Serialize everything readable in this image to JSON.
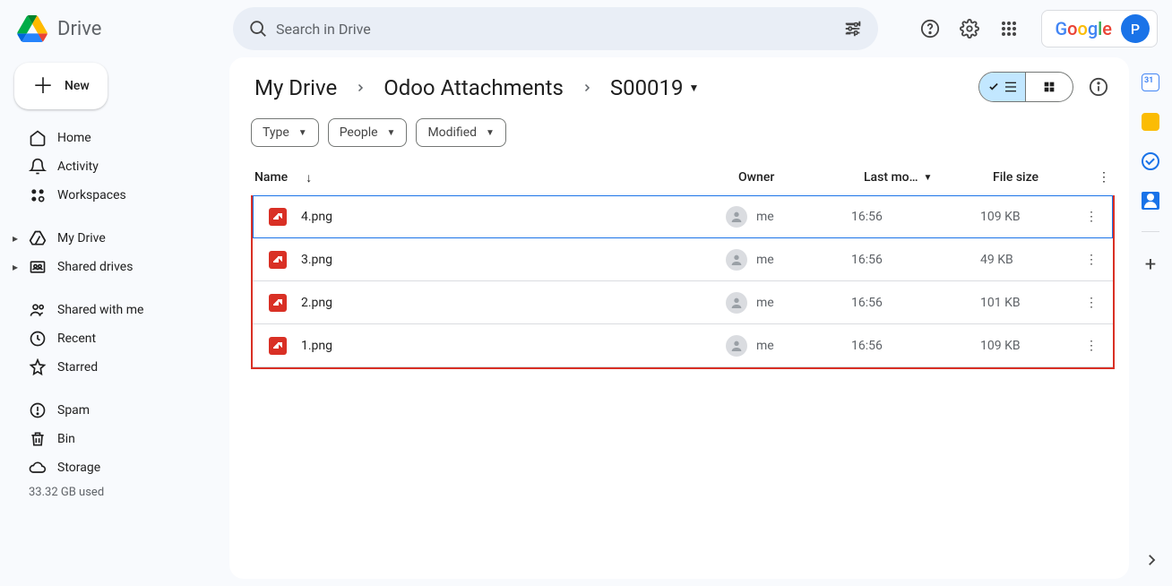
{
  "app": {
    "name": "Drive"
  },
  "search": {
    "placeholder": "Search in Drive"
  },
  "account": {
    "logo": "Google",
    "initial": "P"
  },
  "newButton": {
    "label": "New"
  },
  "sidebar": {
    "home": "Home",
    "activity": "Activity",
    "workspaces": "Workspaces",
    "mydrive": "My Drive",
    "shareddrives": "Shared drives",
    "shared": "Shared with me",
    "recent": "Recent",
    "starred": "Starred",
    "spam": "Spam",
    "bin": "Bin",
    "storage": "Storage",
    "storageUsed": "33.32 GB used"
  },
  "breadcrumbs": {
    "a": "My Drive",
    "b": "Odoo Attachments",
    "c": "S00019"
  },
  "filters": {
    "type": "Type",
    "people": "People",
    "modified": "Modified"
  },
  "columns": {
    "name": "Name",
    "owner": "Owner",
    "modified": "Last mo…",
    "size": "File size"
  },
  "files": {
    "0": {
      "name": "4.png",
      "owner": "me",
      "modified": "16:56",
      "size": "109 KB"
    },
    "1": {
      "name": "3.png",
      "owner": "me",
      "modified": "16:56",
      "size": "49 KB"
    },
    "2": {
      "name": "2.png",
      "owner": "me",
      "modified": "16:56",
      "size": "101 KB"
    },
    "3": {
      "name": "1.png",
      "owner": "me",
      "modified": "16:56",
      "size": "109 KB"
    }
  }
}
